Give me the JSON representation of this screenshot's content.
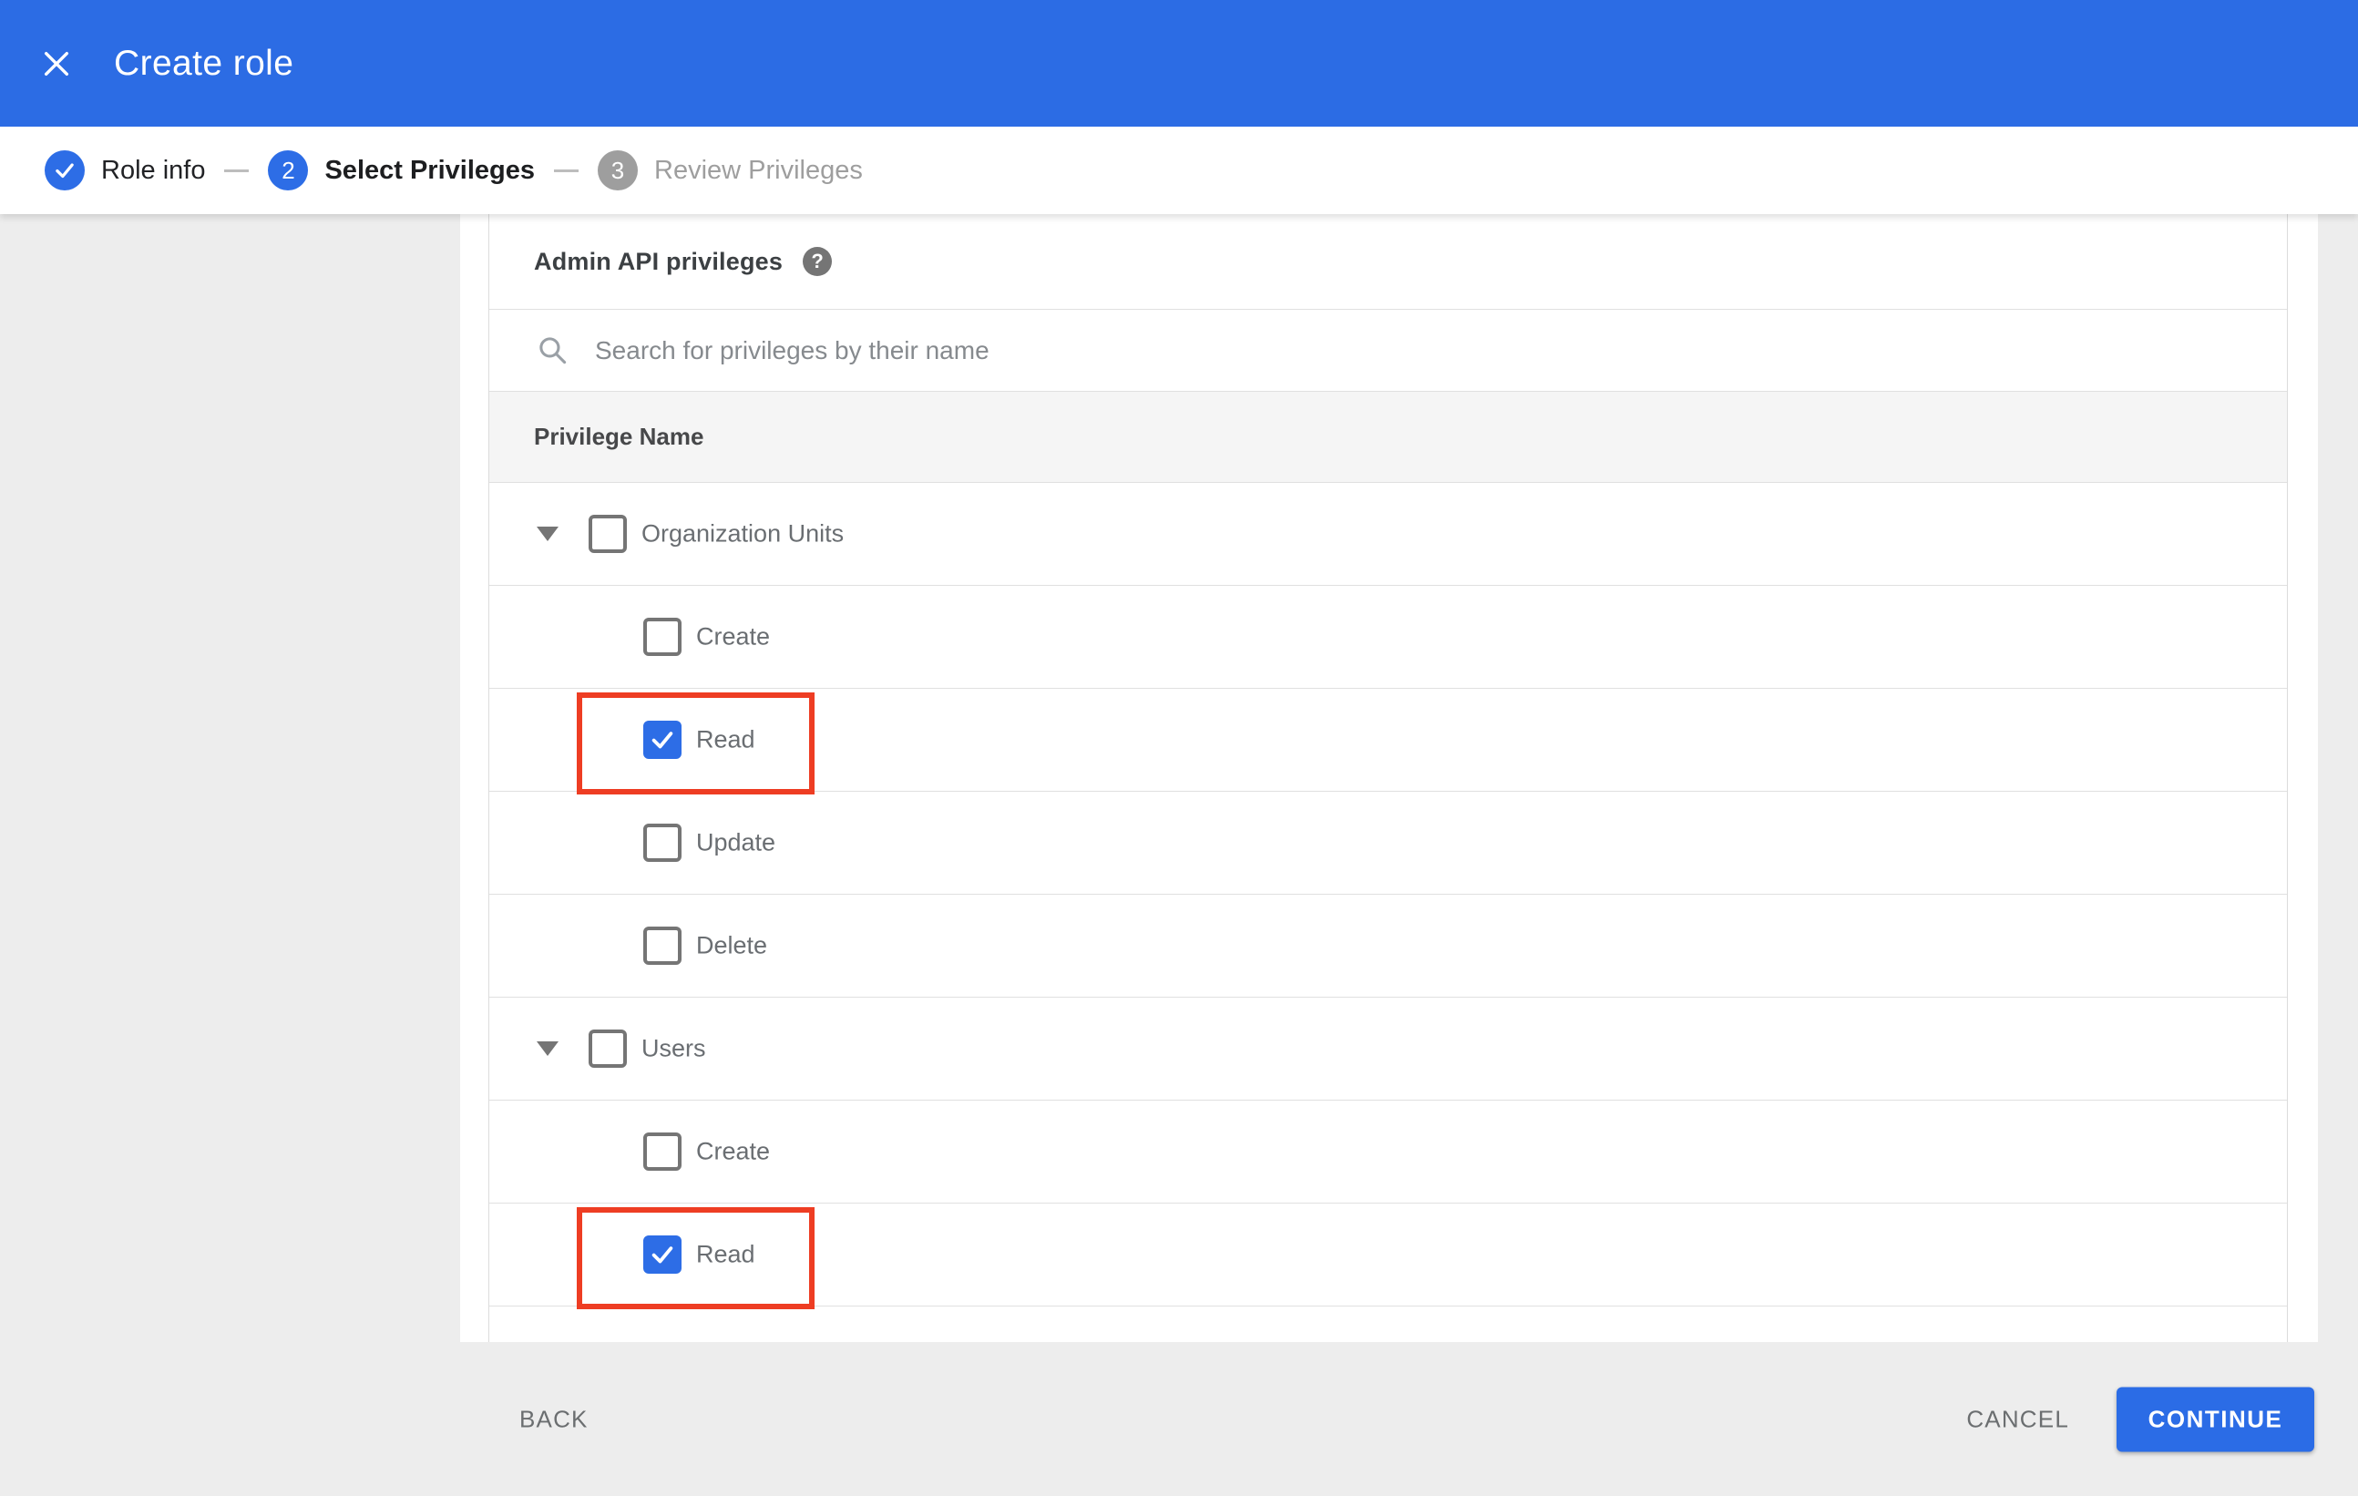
{
  "header": {
    "title": "Create role"
  },
  "stepper": {
    "steps": [
      {
        "label": "Role info",
        "state": "done",
        "icon": "check"
      },
      {
        "label": "Select Privileges",
        "state": "active",
        "number": "2"
      },
      {
        "label": "Review Privileges",
        "state": "future",
        "number": "3"
      }
    ]
  },
  "panel": {
    "title": "Admin API privileges",
    "help_icon": "?",
    "search_placeholder": "Search for privileges by their name",
    "column_header": "Privilege Name"
  },
  "privileges": {
    "rows": [
      {
        "type": "group",
        "label": "Organization Units",
        "checked": false,
        "expanded": true,
        "highlight": false
      },
      {
        "type": "child",
        "label": "Create",
        "checked": false,
        "highlight": false
      },
      {
        "type": "child",
        "label": "Read",
        "checked": true,
        "highlight": true
      },
      {
        "type": "child",
        "label": "Update",
        "checked": false,
        "highlight": false
      },
      {
        "type": "child",
        "label": "Delete",
        "checked": false,
        "highlight": false
      },
      {
        "type": "group",
        "label": "Users",
        "checked": false,
        "expanded": true,
        "highlight": false
      },
      {
        "type": "child",
        "label": "Create",
        "checked": false,
        "highlight": false
      },
      {
        "type": "child",
        "label": "Read",
        "checked": true,
        "highlight": true
      }
    ]
  },
  "footer": {
    "back_label": "BACK",
    "cancel_label": "CANCEL",
    "continue_label": "CONTINUE"
  },
  "colors": {
    "appbar_blue": "#2c6ce4",
    "accent_blue": "#2d6de6",
    "highlight_red": "#ee3d23",
    "page_bg": "#ededed",
    "band_bg": "#f5f5f5",
    "divider": "#e0e0e0"
  }
}
